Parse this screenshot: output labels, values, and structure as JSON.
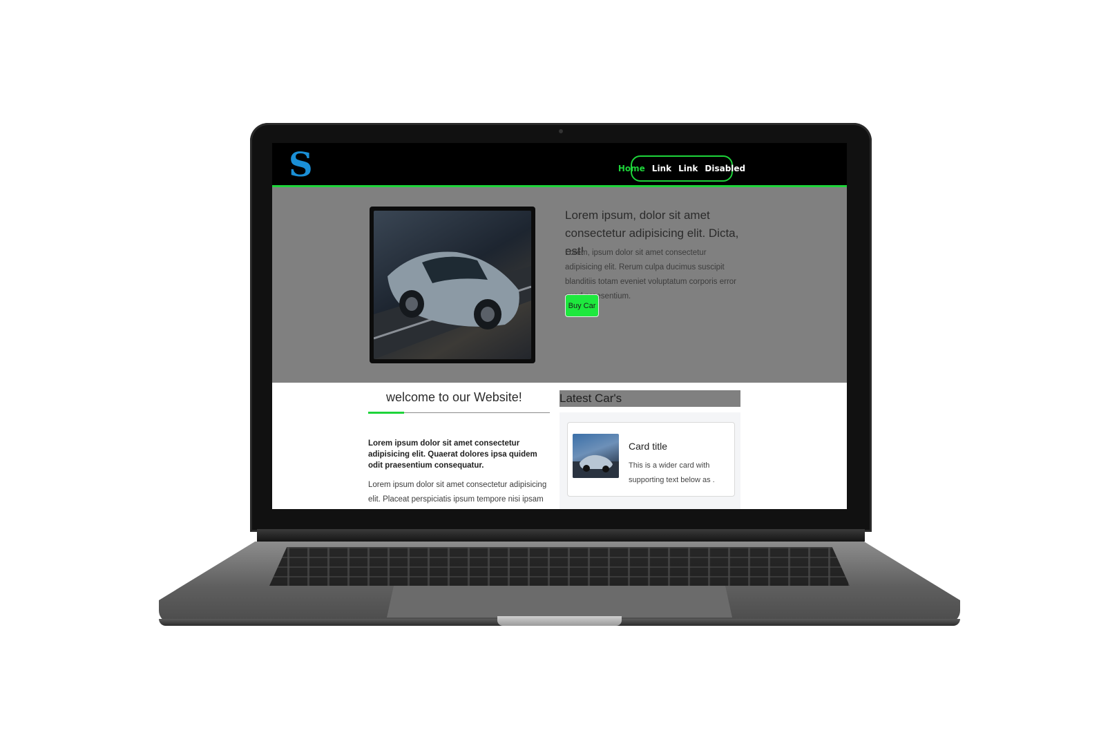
{
  "navbar": {
    "logo_letter": "S",
    "links": [
      {
        "label": "Home",
        "active": true
      },
      {
        "label": "Link",
        "active": false
      },
      {
        "label": "Link",
        "active": false
      },
      {
        "label": "Disabled",
        "active": false
      }
    ],
    "accent_color": "#1ed43a"
  },
  "hero": {
    "title": "Lorem ipsum, dolor sit amet consectetur adipisicing elit. Dicta, est!",
    "text": "Lorem, ipsum dolor sit amet consectetur adipisicing elit. Rerum culpa ducimus suscipit blanditiis totam eveniet voluptatum corporis error quod praesentium.",
    "button_label": "Buy Car",
    "background": "#808080"
  },
  "welcome": {
    "heading": "welcome to our Website!",
    "lead": "Lorem ipsum dolor sit amet consectetur adipisicing elit. Quaerat dolores ipsa quidem odit praesentium consequatur.",
    "body": "Lorem ipsum dolor sit amet consectetur adipisicing elit. Placeat perspiciatis ipsum tempore nisi ipsam molestiae aut"
  },
  "latest": {
    "heading": "Latest Car's",
    "card": {
      "title": "Card title",
      "text": "This is a wider card with supporting text below as ."
    }
  }
}
